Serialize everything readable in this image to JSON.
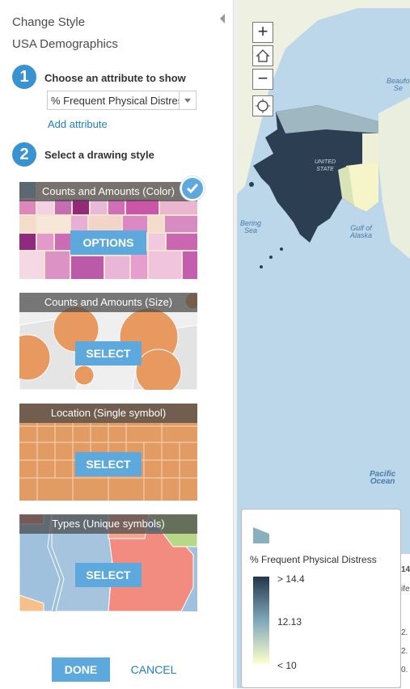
{
  "panel": {
    "title": "Change Style",
    "layer_name": "USA Demographics"
  },
  "step1": {
    "number": "1",
    "label": "Choose an attribute to show",
    "attribute_value": "% Frequent Physical Distress",
    "add_attribute_link": "Add attribute"
  },
  "step2": {
    "number": "2",
    "label": "Select a drawing style"
  },
  "styles": [
    {
      "title": "Counts and Amounts (Color)",
      "button": "OPTIONS",
      "selected": true
    },
    {
      "title": "Counts and Amounts (Size)",
      "button": "SELECT",
      "selected": false
    },
    {
      "title": "Location (Single symbol)",
      "button": "SELECT",
      "selected": false
    },
    {
      "title": "Types (Unique symbols)",
      "button": "SELECT",
      "selected": false
    }
  ],
  "footer": {
    "done": "DONE",
    "cancel": "CANCEL"
  },
  "map": {
    "zoom_in": "+",
    "zoom_out": "−",
    "labels": {
      "beaufort": "Beaufo\nSe",
      "united_states": "UNITED\nSTATE",
      "bering": "Bering\nSea",
      "alaska_gulf": "Gulf of\nAlaska",
      "pacific": "Pacific\nOcean"
    }
  },
  "legend": {
    "title": "% Frequent Physical Distress",
    "high": "> 14.4",
    "mid": "12.13",
    "low": "< 10"
  },
  "table_peek": {
    "values": [
      "14",
      "ife",
      "2.",
      "2.",
      "0."
    ]
  },
  "colors": {
    "accent": "#5da9dd",
    "step": "#3a93d1",
    "link": "#1f7fc0",
    "ramp_high": "#24374b",
    "ramp_low": "#ffffcc"
  }
}
